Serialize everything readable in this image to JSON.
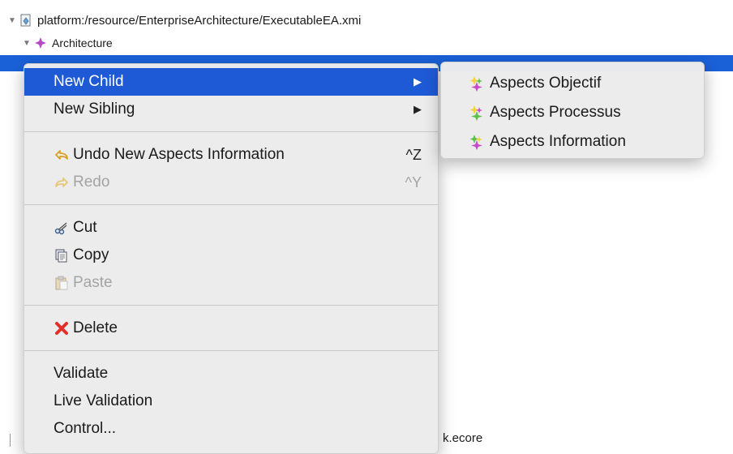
{
  "tree": {
    "resource_label": "platform:/resource/EnterpriseArchitecture/ExecutableEA.xmi",
    "architecture_label": "Architecture",
    "partial_label": "k.ecore"
  },
  "menu": {
    "new_child": "New Child",
    "new_sibling": "New Sibling",
    "undo": "Undo New Aspects Information",
    "undo_shortcut": "^Z",
    "redo": "Redo",
    "redo_shortcut": "^Y",
    "cut": "Cut",
    "copy": "Copy",
    "paste": "Paste",
    "delete": "Delete",
    "validate": "Validate",
    "live_validation": "Live Validation",
    "control": "Control..."
  },
  "submenu": {
    "items": [
      "Aspects Objectif",
      "Aspects Processus",
      "Aspects Information"
    ]
  },
  "colors": {
    "selection": "#1f5ad6",
    "menu_bg": "#ececec",
    "disabled_text": "#a4a4a4"
  }
}
